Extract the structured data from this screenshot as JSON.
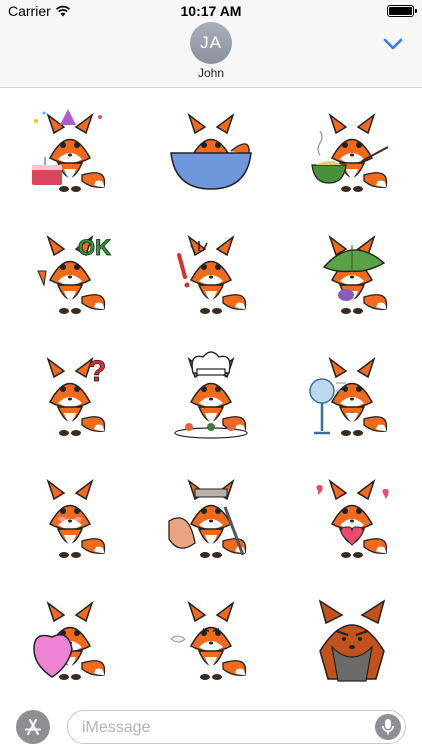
{
  "status_bar": {
    "carrier": "Carrier",
    "time": "10:17 AM",
    "battery_level_percent": 100,
    "icons": [
      "wifi-icon",
      "battery-icon"
    ]
  },
  "header": {
    "avatar_initials": "JA",
    "contact_name": "John",
    "collapse_icon": "chevron-down-icon",
    "accent_color": "#2f7cf6"
  },
  "stickers": [
    {
      "name": "fox-birthday-cake-sticker",
      "text": ""
    },
    {
      "name": "fox-peeking-blue-bowl-sticker",
      "text": ""
    },
    {
      "name": "fox-eating-noodles-sticker",
      "text": ""
    },
    {
      "name": "fox-thumbs-up-ok-sticker",
      "text": "OK"
    },
    {
      "name": "fox-shocked-sticker",
      "text": ""
    },
    {
      "name": "fox-hiding-under-leaf-sticker",
      "text": ""
    },
    {
      "name": "fox-confused-question-sticker",
      "text": "?"
    },
    {
      "name": "fox-chef-sushi-sticker",
      "text": ""
    },
    {
      "name": "fox-with-fan-sticker",
      "text": ""
    },
    {
      "name": "fox-shy-sticker",
      "text": ""
    },
    {
      "name": "fox-samurai-sticker",
      "text": ""
    },
    {
      "name": "fox-love-hearts-sticker",
      "text": ""
    },
    {
      "name": "fox-holding-pink-heart-sticker",
      "text": ""
    },
    {
      "name": "fox-angry-huff-sticker",
      "text": ""
    },
    {
      "name": "fox-grumpy-old-sticker",
      "text": ""
    }
  ],
  "input_bar": {
    "app_store_icon": "app-store-icon",
    "placeholder": "iMessage",
    "mic_icon": "microphone-icon"
  }
}
